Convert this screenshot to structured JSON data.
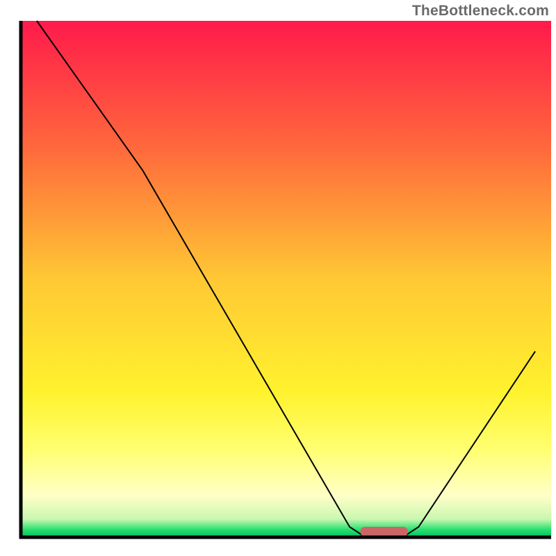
{
  "watermark": "TheBottleneck.com",
  "chart_data": {
    "type": "line",
    "title": "",
    "xlabel": "",
    "ylabel": "",
    "xlim": [
      0,
      100
    ],
    "ylim": [
      0,
      100
    ],
    "grid": false,
    "legend": false,
    "background": {
      "type": "vertical-gradient",
      "stops": [
        {
          "pos": 0.0,
          "color": "#ff1a4b"
        },
        {
          "pos": 0.25,
          "color": "#ff6a3c"
        },
        {
          "pos": 0.5,
          "color": "#ffc834"
        },
        {
          "pos": 0.72,
          "color": "#fff22e"
        },
        {
          "pos": 0.83,
          "color": "#ffff70"
        },
        {
          "pos": 0.92,
          "color": "#ffffc8"
        },
        {
          "pos": 0.965,
          "color": "#c9f7b0"
        },
        {
          "pos": 0.985,
          "color": "#28e070"
        },
        {
          "pos": 1.0,
          "color": "#00c060"
        }
      ]
    },
    "series": [
      {
        "name": "bottleneck-curve",
        "stroke": "#000000",
        "stroke_width": 2,
        "points": [
          {
            "x": 3,
            "y": 100
          },
          {
            "x": 23,
            "y": 71
          },
          {
            "x": 62,
            "y": 2
          },
          {
            "x": 65,
            "y": 0
          },
          {
            "x": 72,
            "y": 0
          },
          {
            "x": 75,
            "y": 2
          },
          {
            "x": 97,
            "y": 36
          }
        ]
      }
    ],
    "marker": {
      "name": "optimal-range-marker",
      "x_start": 64,
      "x_end": 73,
      "y": 0,
      "color": "#cc6666"
    }
  }
}
